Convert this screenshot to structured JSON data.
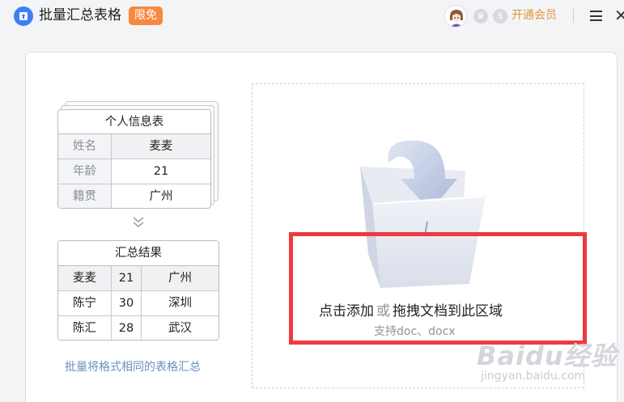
{
  "app": {
    "title": "批量汇总表格",
    "badge": "限免",
    "vip_label": "开通会员"
  },
  "sample_table": {
    "title": "个人信息表",
    "rows": [
      {
        "label": "姓名",
        "value": "麦麦"
      },
      {
        "label": "年龄",
        "value": "21"
      },
      {
        "label": "籍贯",
        "value": "广州"
      }
    ]
  },
  "result_table": {
    "title": "汇总结果",
    "rows": [
      [
        "麦麦",
        "21",
        "广州"
      ],
      [
        "陈宁",
        "30",
        "深圳"
      ],
      [
        "陈汇",
        "28",
        "武汉"
      ]
    ]
  },
  "description": "批量将格式相同的表格汇总",
  "dropzone": {
    "click_add": "点击添加",
    "or": "或",
    "drag_hint": "拖拽文档到此区域",
    "support": "支持doc、docx"
  },
  "watermark": {
    "brand": "Baidu经验",
    "url": "jingyan.baidu.com"
  },
  "colors": {
    "accent": "#3d7ff6",
    "badge": "#f5893f",
    "vip": "#e5963a",
    "highlight_box": "#ee3a3f"
  }
}
